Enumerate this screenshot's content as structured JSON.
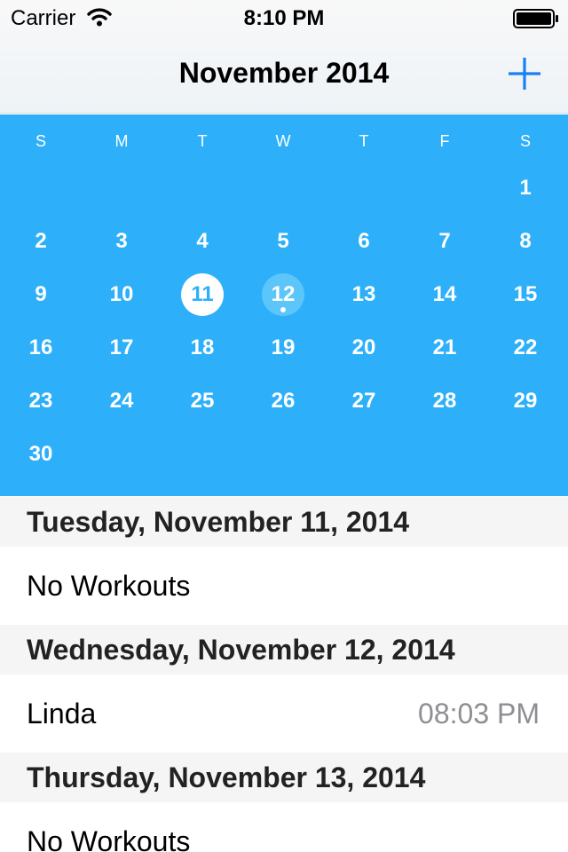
{
  "status_bar": {
    "carrier": "Carrier",
    "time": "8:10 PM"
  },
  "nav": {
    "title": "November 2014",
    "add_icon": "plus-icon"
  },
  "calendar": {
    "weekdays": [
      "S",
      "M",
      "T",
      "W",
      "T",
      "F",
      "S"
    ],
    "month": "November 2014",
    "first_weekday_index": 6,
    "days_in_month": 30,
    "selected_day": "11",
    "today_day": "12",
    "event_days": [
      "12"
    ],
    "accent_color": "#2db0f9"
  },
  "list": {
    "sections": [
      {
        "header": "Tuesday, November 11, 2014",
        "rows": [
          {
            "title": "No Workouts",
            "detail": ""
          }
        ]
      },
      {
        "header": "Wednesday, November 12, 2014",
        "rows": [
          {
            "title": "Linda",
            "detail": "08:03 PM"
          }
        ]
      },
      {
        "header": "Thursday, November 13, 2014",
        "rows": [
          {
            "title": "No Workouts",
            "detail": ""
          }
        ]
      }
    ]
  }
}
